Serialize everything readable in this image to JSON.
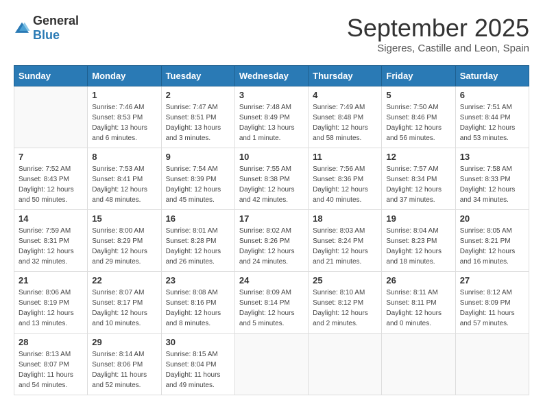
{
  "logo": {
    "general": "General",
    "blue": "Blue"
  },
  "header": {
    "month": "September 2025",
    "subtitle": "Sigeres, Castille and Leon, Spain"
  },
  "weekdays": [
    "Sunday",
    "Monday",
    "Tuesday",
    "Wednesday",
    "Thursday",
    "Friday",
    "Saturday"
  ],
  "weeks": [
    [
      {
        "day": "",
        "info": ""
      },
      {
        "day": "1",
        "info": "Sunrise: 7:46 AM\nSunset: 8:53 PM\nDaylight: 13 hours\nand 6 minutes."
      },
      {
        "day": "2",
        "info": "Sunrise: 7:47 AM\nSunset: 8:51 PM\nDaylight: 13 hours\nand 3 minutes."
      },
      {
        "day": "3",
        "info": "Sunrise: 7:48 AM\nSunset: 8:49 PM\nDaylight: 13 hours\nand 1 minute."
      },
      {
        "day": "4",
        "info": "Sunrise: 7:49 AM\nSunset: 8:48 PM\nDaylight: 12 hours\nand 58 minutes."
      },
      {
        "day": "5",
        "info": "Sunrise: 7:50 AM\nSunset: 8:46 PM\nDaylight: 12 hours\nand 56 minutes."
      },
      {
        "day": "6",
        "info": "Sunrise: 7:51 AM\nSunset: 8:44 PM\nDaylight: 12 hours\nand 53 minutes."
      }
    ],
    [
      {
        "day": "7",
        "info": "Sunrise: 7:52 AM\nSunset: 8:43 PM\nDaylight: 12 hours\nand 50 minutes."
      },
      {
        "day": "8",
        "info": "Sunrise: 7:53 AM\nSunset: 8:41 PM\nDaylight: 12 hours\nand 48 minutes."
      },
      {
        "day": "9",
        "info": "Sunrise: 7:54 AM\nSunset: 8:39 PM\nDaylight: 12 hours\nand 45 minutes."
      },
      {
        "day": "10",
        "info": "Sunrise: 7:55 AM\nSunset: 8:38 PM\nDaylight: 12 hours\nand 42 minutes."
      },
      {
        "day": "11",
        "info": "Sunrise: 7:56 AM\nSunset: 8:36 PM\nDaylight: 12 hours\nand 40 minutes."
      },
      {
        "day": "12",
        "info": "Sunrise: 7:57 AM\nSunset: 8:34 PM\nDaylight: 12 hours\nand 37 minutes."
      },
      {
        "day": "13",
        "info": "Sunrise: 7:58 AM\nSunset: 8:33 PM\nDaylight: 12 hours\nand 34 minutes."
      }
    ],
    [
      {
        "day": "14",
        "info": "Sunrise: 7:59 AM\nSunset: 8:31 PM\nDaylight: 12 hours\nand 32 minutes."
      },
      {
        "day": "15",
        "info": "Sunrise: 8:00 AM\nSunset: 8:29 PM\nDaylight: 12 hours\nand 29 minutes."
      },
      {
        "day": "16",
        "info": "Sunrise: 8:01 AM\nSunset: 8:28 PM\nDaylight: 12 hours\nand 26 minutes."
      },
      {
        "day": "17",
        "info": "Sunrise: 8:02 AM\nSunset: 8:26 PM\nDaylight: 12 hours\nand 24 minutes."
      },
      {
        "day": "18",
        "info": "Sunrise: 8:03 AM\nSunset: 8:24 PM\nDaylight: 12 hours\nand 21 minutes."
      },
      {
        "day": "19",
        "info": "Sunrise: 8:04 AM\nSunset: 8:23 PM\nDaylight: 12 hours\nand 18 minutes."
      },
      {
        "day": "20",
        "info": "Sunrise: 8:05 AM\nSunset: 8:21 PM\nDaylight: 12 hours\nand 16 minutes."
      }
    ],
    [
      {
        "day": "21",
        "info": "Sunrise: 8:06 AM\nSunset: 8:19 PM\nDaylight: 12 hours\nand 13 minutes."
      },
      {
        "day": "22",
        "info": "Sunrise: 8:07 AM\nSunset: 8:17 PM\nDaylight: 12 hours\nand 10 minutes."
      },
      {
        "day": "23",
        "info": "Sunrise: 8:08 AM\nSunset: 8:16 PM\nDaylight: 12 hours\nand 8 minutes."
      },
      {
        "day": "24",
        "info": "Sunrise: 8:09 AM\nSunset: 8:14 PM\nDaylight: 12 hours\nand 5 minutes."
      },
      {
        "day": "25",
        "info": "Sunrise: 8:10 AM\nSunset: 8:12 PM\nDaylight: 12 hours\nand 2 minutes."
      },
      {
        "day": "26",
        "info": "Sunrise: 8:11 AM\nSunset: 8:11 PM\nDaylight: 12 hours\nand 0 minutes."
      },
      {
        "day": "27",
        "info": "Sunrise: 8:12 AM\nSunset: 8:09 PM\nDaylight: 11 hours\nand 57 minutes."
      }
    ],
    [
      {
        "day": "28",
        "info": "Sunrise: 8:13 AM\nSunset: 8:07 PM\nDaylight: 11 hours\nand 54 minutes."
      },
      {
        "day": "29",
        "info": "Sunrise: 8:14 AM\nSunset: 8:06 PM\nDaylight: 11 hours\nand 52 minutes."
      },
      {
        "day": "30",
        "info": "Sunrise: 8:15 AM\nSunset: 8:04 PM\nDaylight: 11 hours\nand 49 minutes."
      },
      {
        "day": "",
        "info": ""
      },
      {
        "day": "",
        "info": ""
      },
      {
        "day": "",
        "info": ""
      },
      {
        "day": "",
        "info": ""
      }
    ]
  ]
}
